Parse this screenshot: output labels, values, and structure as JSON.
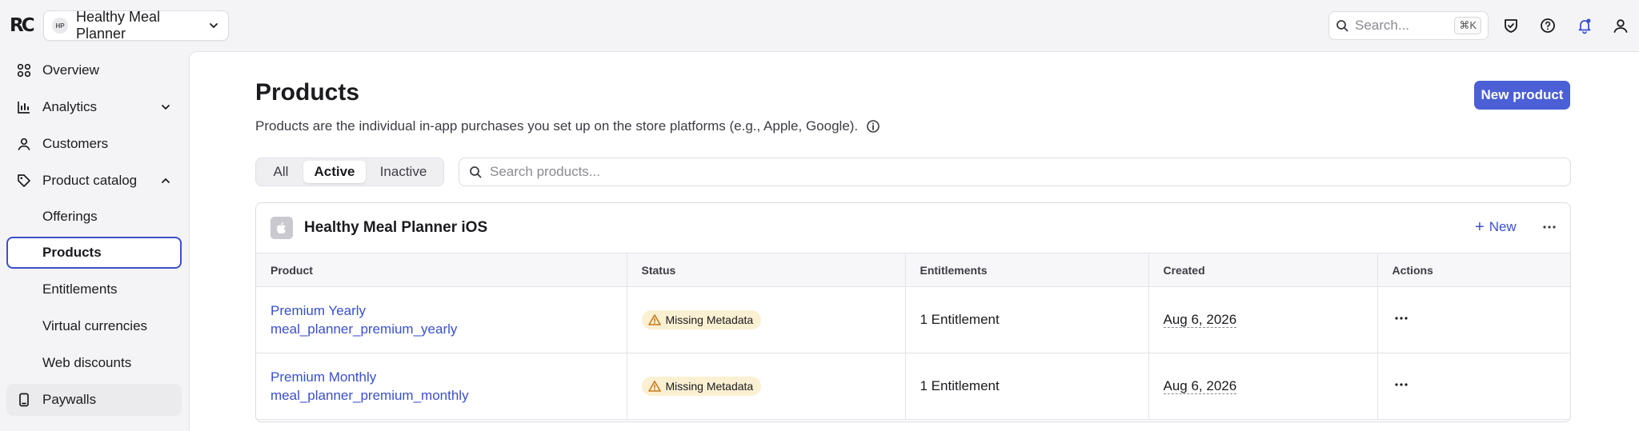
{
  "app": {
    "logo_text": "RC",
    "project_initials": "HP",
    "project_name": "Healthy Meal Planner"
  },
  "topbar": {
    "search_placeholder": "Search...",
    "search_shortcut": "⌘K"
  },
  "sidebar": {
    "items": [
      {
        "label": "Overview",
        "icon": "grid-icon"
      },
      {
        "label": "Analytics",
        "icon": "bar-chart-icon"
      },
      {
        "label": "Customers",
        "icon": "user-icon"
      },
      {
        "label": "Product catalog",
        "icon": "tag-icon"
      },
      {
        "label": "Paywalls",
        "icon": "phone-icon"
      }
    ],
    "subitems": [
      "Offerings",
      "Products",
      "Entitlements",
      "Virtual currencies",
      "Web discounts"
    ]
  },
  "main": {
    "title": "Products",
    "description": "Products are the individual in-app purchases you set up on the store platforms (e.g., Apple, Google).",
    "new_product_label": "New product",
    "filters": [
      "All",
      "Active",
      "Inactive"
    ],
    "active_filter": "Active",
    "search_placeholder": "Search products..."
  },
  "card": {
    "title": "Healthy Meal Planner iOS",
    "new_label": "New",
    "columns": [
      "Product",
      "Status",
      "Entitlements",
      "Created",
      "Actions"
    ],
    "rows": [
      {
        "name": "Premium Yearly",
        "identifier": "meal_planner_premium_yearly",
        "status": "Missing Metadata",
        "entitlements": "1 Entitlement",
        "created": "Aug 6, 2026"
      },
      {
        "name": "Premium Monthly",
        "identifier": "meal_planner_premium_monthly",
        "status": "Missing Metadata",
        "entitlements": "1 Entitlement",
        "created": "Aug 6, 2026"
      }
    ]
  },
  "colors": {
    "accent": "#4b5fd6",
    "link": "#3a4fcf",
    "warning_badge_bg": "#fbf0d2",
    "warning_icon": "#c9781b"
  }
}
